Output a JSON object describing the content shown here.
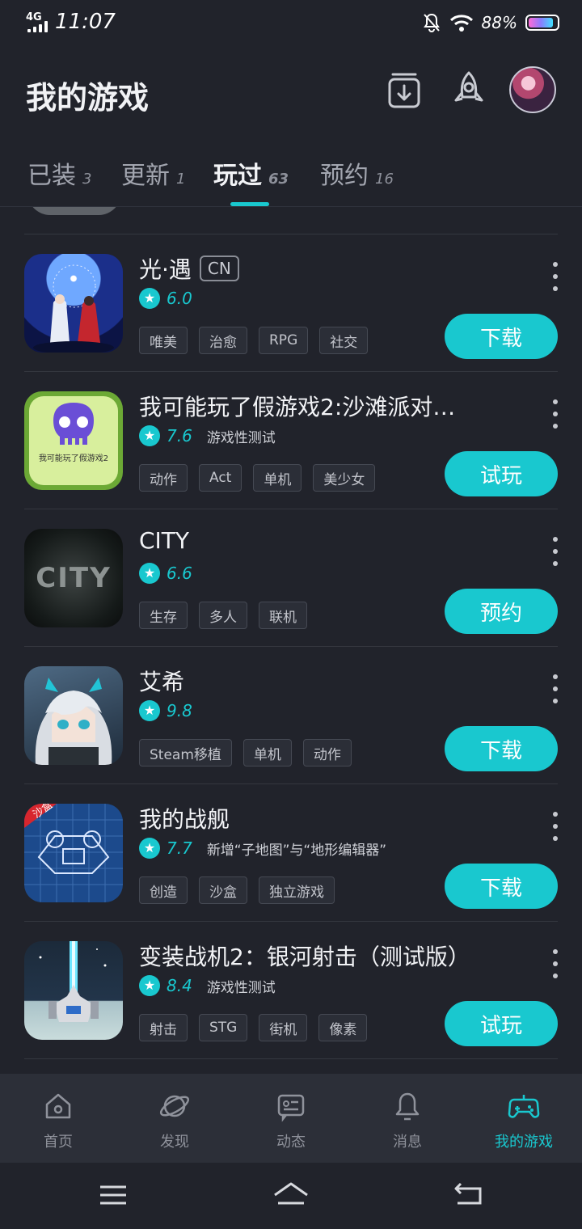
{
  "status_bar": {
    "network": "4G",
    "time": "11:07",
    "battery": "88%"
  },
  "header": {
    "title": "我的游戏"
  },
  "tabs": [
    {
      "label": "已装",
      "count": "3"
    },
    {
      "label": "更新",
      "count": "1"
    },
    {
      "label": "玩过",
      "count": "63"
    },
    {
      "label": "预约",
      "count": "16"
    }
  ],
  "games": [
    {
      "name": "光·遇",
      "badge": "CN",
      "score": "6.0",
      "note": "",
      "tags": [
        "唯美",
        "治愈",
        "RPG",
        "社交"
      ],
      "action": "下载",
      "icon": "sky-game-icon"
    },
    {
      "name": "我可能玩了假游戏2:沙滩派对…",
      "badge": "",
      "score": "7.6",
      "note": "游戏性测试",
      "tags": [
        "动作",
        "Act",
        "单机",
        "美少女"
      ],
      "action": "试玩",
      "icon": "skull-game-icon",
      "icon_caption": "我可能玩了假游戏2"
    },
    {
      "name": "CITY",
      "badge": "",
      "score": "6.6",
      "note": "",
      "tags": [
        "生存",
        "多人",
        "联机"
      ],
      "action": "预约",
      "icon": "city-game-icon",
      "icon_caption": "CITY"
    },
    {
      "name": "艾希",
      "badge": "",
      "score": "9.8",
      "note": "",
      "tags": [
        "Steam移植",
        "单机",
        "动作"
      ],
      "action": "下载",
      "icon": "anime-girl-game-icon"
    },
    {
      "name": "我的战舰",
      "badge": "",
      "score": "7.7",
      "note": "新增“子地图”与“地形编辑器”",
      "tags": [
        "创造",
        "沙盒",
        "独立游戏"
      ],
      "action": "下载",
      "icon": "warship-game-icon",
      "icon_caption": "沙盒"
    },
    {
      "name": "变装战机2：银河射击（测试版）",
      "badge": "",
      "score": "8.4",
      "note": "游戏性测试",
      "tags": [
        "射击",
        "STG",
        "街机",
        "像素"
      ],
      "action": "试玩",
      "icon": "fighter-jet-game-icon"
    }
  ],
  "bottom_nav": [
    {
      "label": "首页",
      "icon": "home-icon"
    },
    {
      "label": "发现",
      "icon": "planet-icon"
    },
    {
      "label": "动态",
      "icon": "feed-icon"
    },
    {
      "label": "消息",
      "icon": "bell-icon"
    },
    {
      "label": "我的游戏",
      "icon": "gamepad-icon",
      "active": true
    }
  ],
  "colors": {
    "accent": "#19c8cf",
    "background": "#21232b",
    "nav_background": "#2c2f38"
  }
}
